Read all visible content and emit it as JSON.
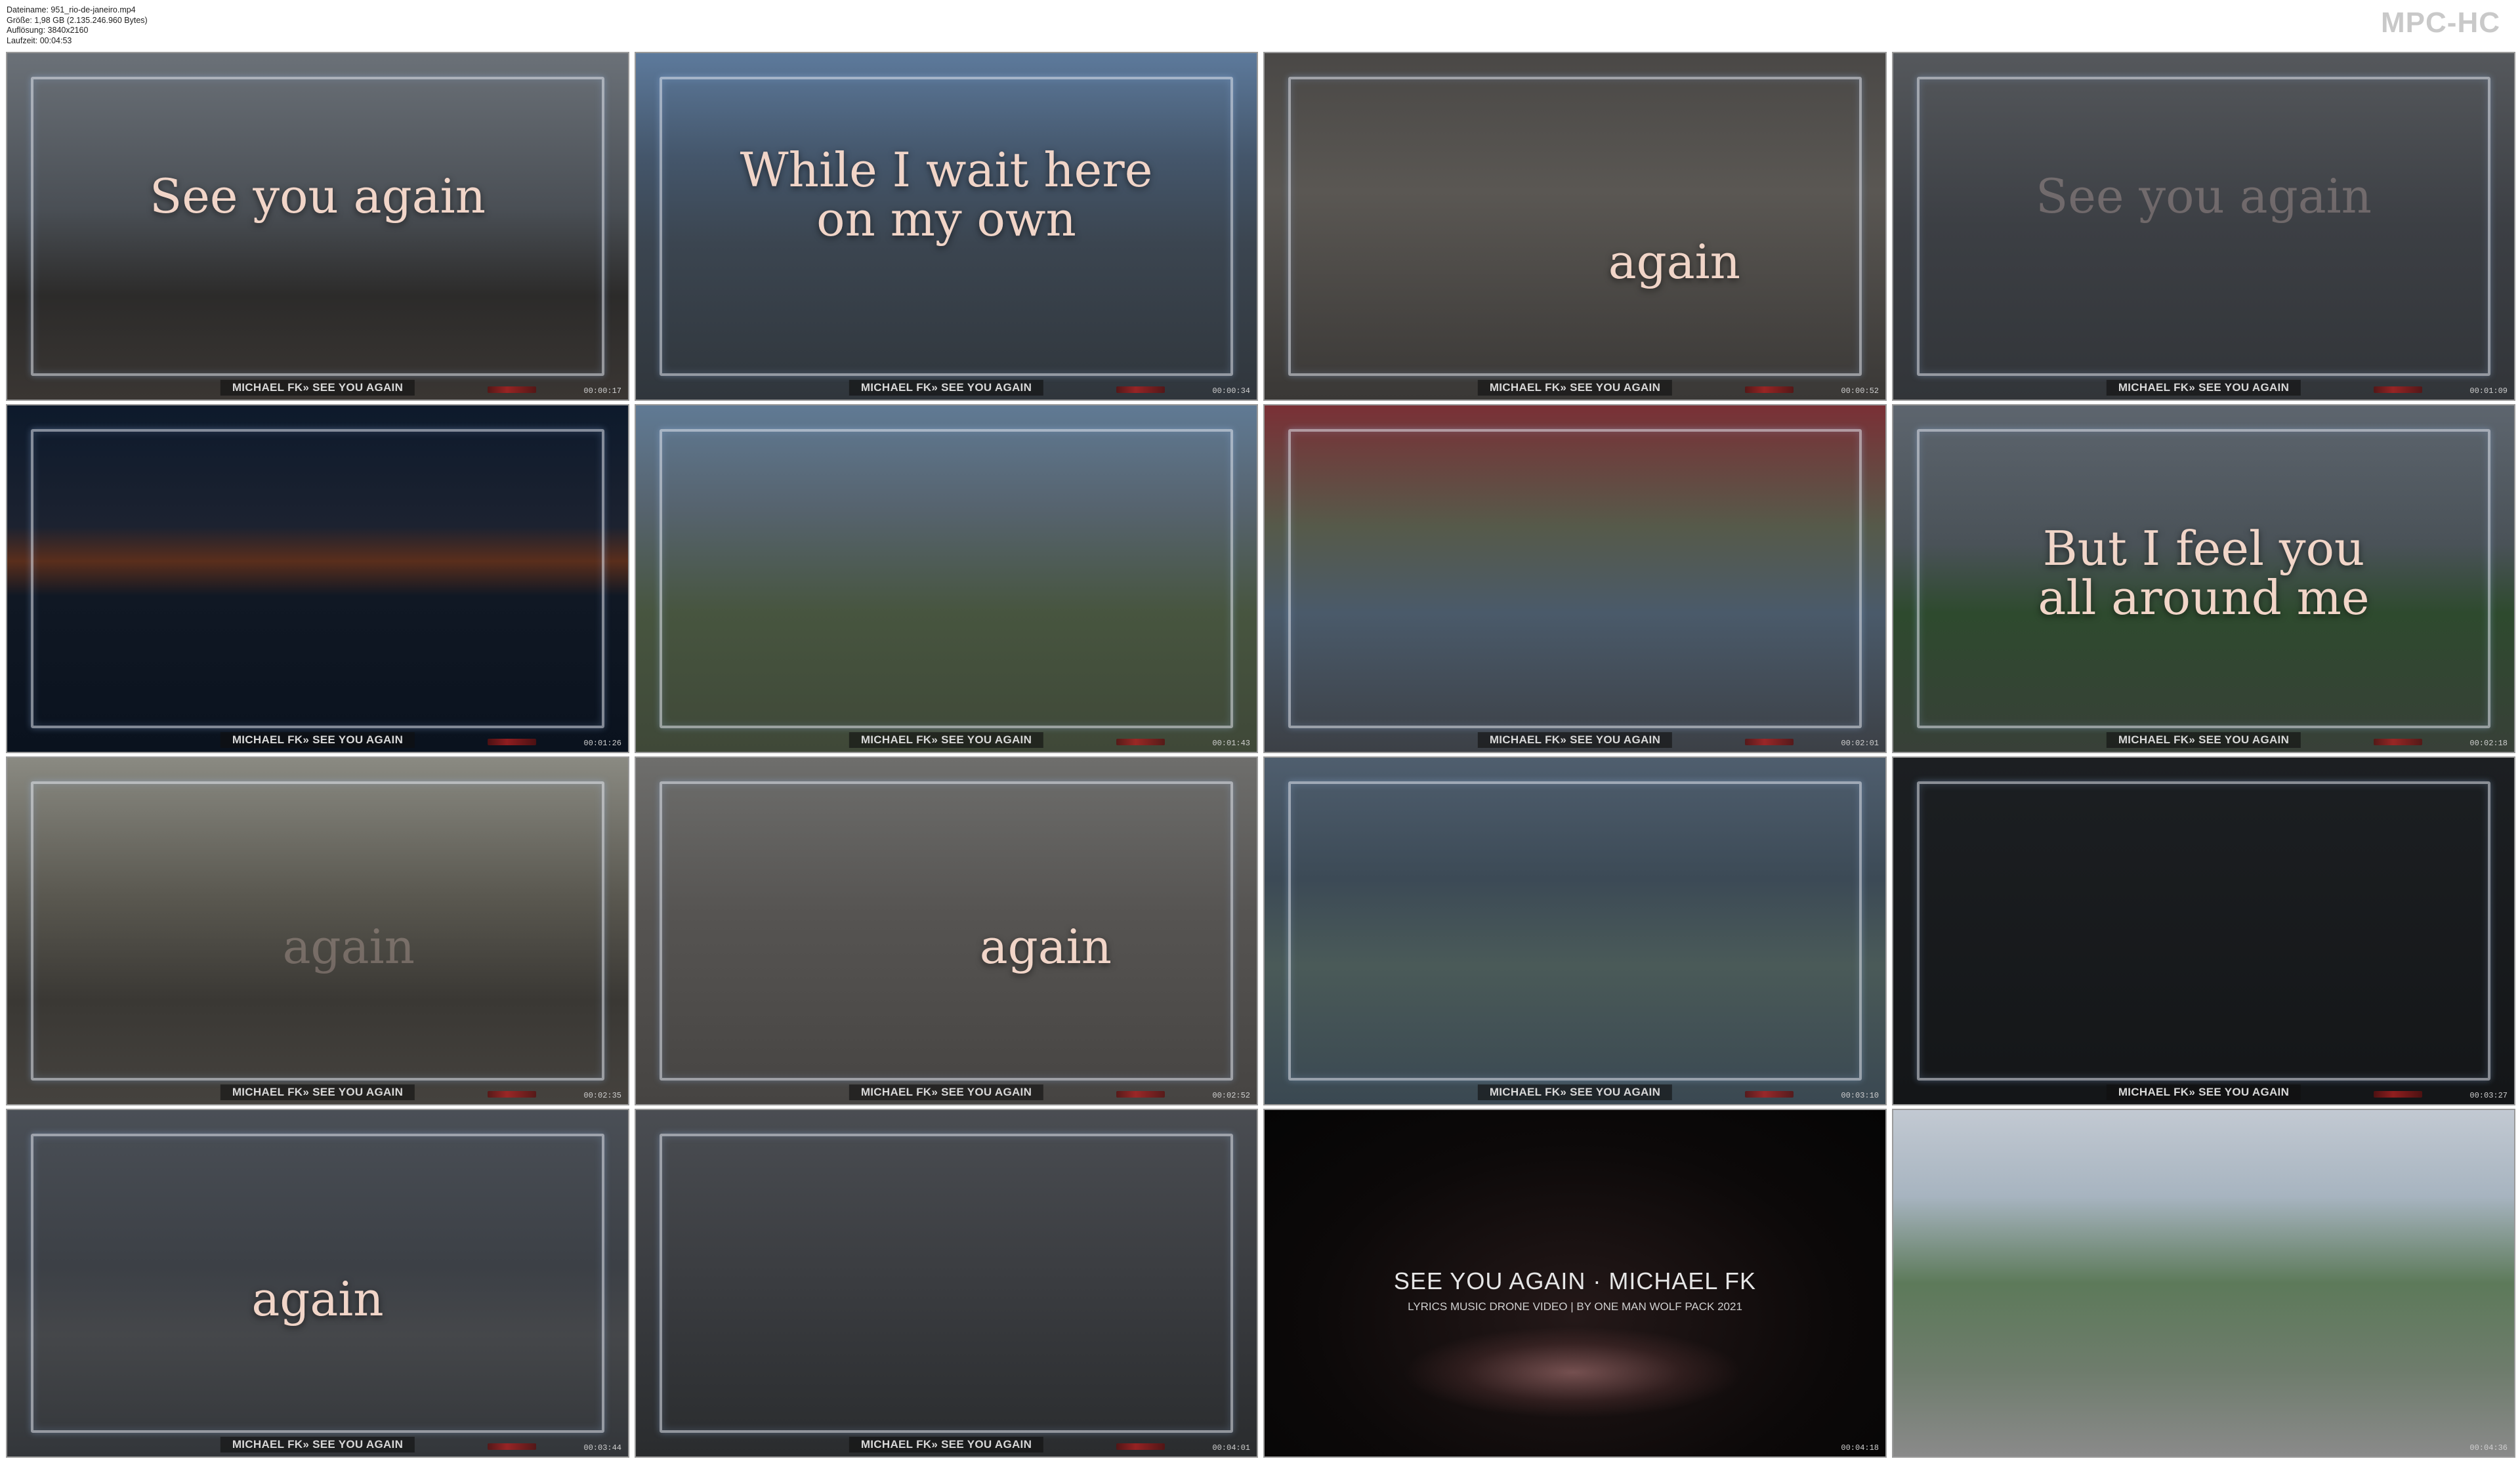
{
  "file_info": {
    "filename": "Dateiname: 951_rio-de-janeiro.mp4",
    "size": "Größe: 1,98 GB (2.135.246.960 Bytes)",
    "resolution": "Auflösung: 3840x2160",
    "duration": "Laufzeit: 00:04:53"
  },
  "logo": "MPC-HC",
  "thumbnails": [
    {
      "timestamp": "00:00:17",
      "caption": "MICHAEL FK» SEE YOU AGAIN",
      "lyric": [
        "See you again"
      ]
    },
    {
      "timestamp": "00:00:34",
      "caption": "MICHAEL FK» SEE YOU AGAIN",
      "lyric": [
        "While I wait here",
        "on my own"
      ]
    },
    {
      "timestamp": "00:00:52",
      "caption": "MICHAEL FK» SEE YOU AGAIN",
      "lyric": [
        "again"
      ]
    },
    {
      "timestamp": "00:01:09",
      "caption": "MICHAEL FK» SEE YOU AGAIN",
      "lyric": [
        "See you again"
      ]
    },
    {
      "timestamp": "00:01:26",
      "caption": "MICHAEL FK» SEE YOU AGAIN",
      "lyric": []
    },
    {
      "timestamp": "00:01:43",
      "caption": "MICHAEL FK» SEE YOU AGAIN",
      "lyric": []
    },
    {
      "timestamp": "00:02:01",
      "caption": "MICHAEL FK» SEE YOU AGAIN",
      "lyric": []
    },
    {
      "timestamp": "00:02:18",
      "caption": "MICHAEL FK» SEE YOU AGAIN",
      "lyric": [
        "But I feel you",
        "all around me"
      ]
    },
    {
      "timestamp": "00:02:35",
      "caption": "MICHAEL FK» SEE YOU AGAIN",
      "lyric": [
        "again"
      ]
    },
    {
      "timestamp": "00:02:52",
      "caption": "MICHAEL FK» SEE YOU AGAIN",
      "lyric": [
        "again"
      ]
    },
    {
      "timestamp": "00:03:10",
      "caption": "MICHAEL FK» SEE YOU AGAIN",
      "lyric": []
    },
    {
      "timestamp": "00:03:27",
      "caption": "MICHAEL FK» SEE YOU AGAIN",
      "lyric": []
    },
    {
      "timestamp": "00:03:44",
      "caption": "MICHAEL FK» SEE YOU AGAIN",
      "lyric": [
        "again"
      ]
    },
    {
      "timestamp": "00:04:01",
      "caption": "MICHAEL FK» SEE YOU AGAIN",
      "lyric": []
    },
    {
      "timestamp": "00:04:18",
      "caption": "",
      "lyric": [],
      "end_title": "SEE YOU AGAIN · MICHAEL FK",
      "end_subtitle": "LYRICS MUSIC DRONE VIDEO | BY ONE MAN WOLF PACK 2021"
    },
    {
      "timestamp": "00:04:36",
      "caption": "",
      "lyric": []
    }
  ]
}
